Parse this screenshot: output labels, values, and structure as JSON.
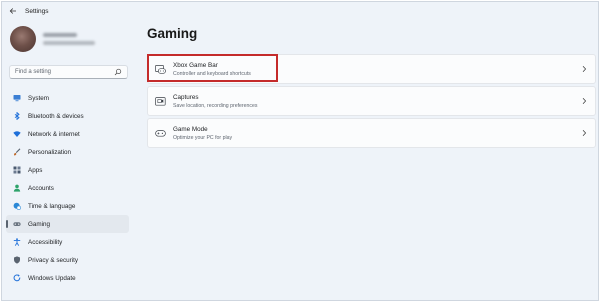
{
  "window": {
    "title": "Settings"
  },
  "sidebar": {
    "search_placeholder": "Find a setting",
    "items": [
      {
        "label": "System",
        "icon": "monitor-icon",
        "color": "#3b7fd4"
      },
      {
        "label": "Bluetooth & devices",
        "icon": "bluetooth-icon",
        "color": "#1e6fd9"
      },
      {
        "label": "Network & internet",
        "icon": "wifi-icon",
        "color": "#1e6fd9"
      },
      {
        "label": "Personalization",
        "icon": "brush-icon",
        "color": "#c06a2b"
      },
      {
        "label": "Apps",
        "icon": "apps-icon",
        "color": "#4a5a70"
      },
      {
        "label": "Accounts",
        "icon": "person-icon",
        "color": "#2ea36b"
      },
      {
        "label": "Time & language",
        "icon": "globe-clock-icon",
        "color": "#2a88d6"
      },
      {
        "label": "Gaming",
        "icon": "gamepad-icon",
        "color": "#6a7480",
        "active": true
      },
      {
        "label": "Accessibility",
        "icon": "accessibility-icon",
        "color": "#1e6fd9"
      },
      {
        "label": "Privacy & security",
        "icon": "shield-icon",
        "color": "#5a6470"
      },
      {
        "label": "Windows Update",
        "icon": "refresh-icon",
        "color": "#1e6fd9"
      }
    ]
  },
  "main": {
    "title": "Gaming",
    "cards": [
      {
        "title": "Xbox Game Bar",
        "subtitle": "Controller and keyboard shortcuts",
        "icon": "game-bar-icon",
        "highlighted": true
      },
      {
        "title": "Captures",
        "subtitle": "Save location, recording preferences",
        "icon": "capture-icon"
      },
      {
        "title": "Game Mode",
        "subtitle": "Optimize your PC for play",
        "icon": "game-mode-icon"
      }
    ]
  },
  "colors": {
    "highlight": "#c42b2b",
    "accent": "#1e6fd9"
  }
}
